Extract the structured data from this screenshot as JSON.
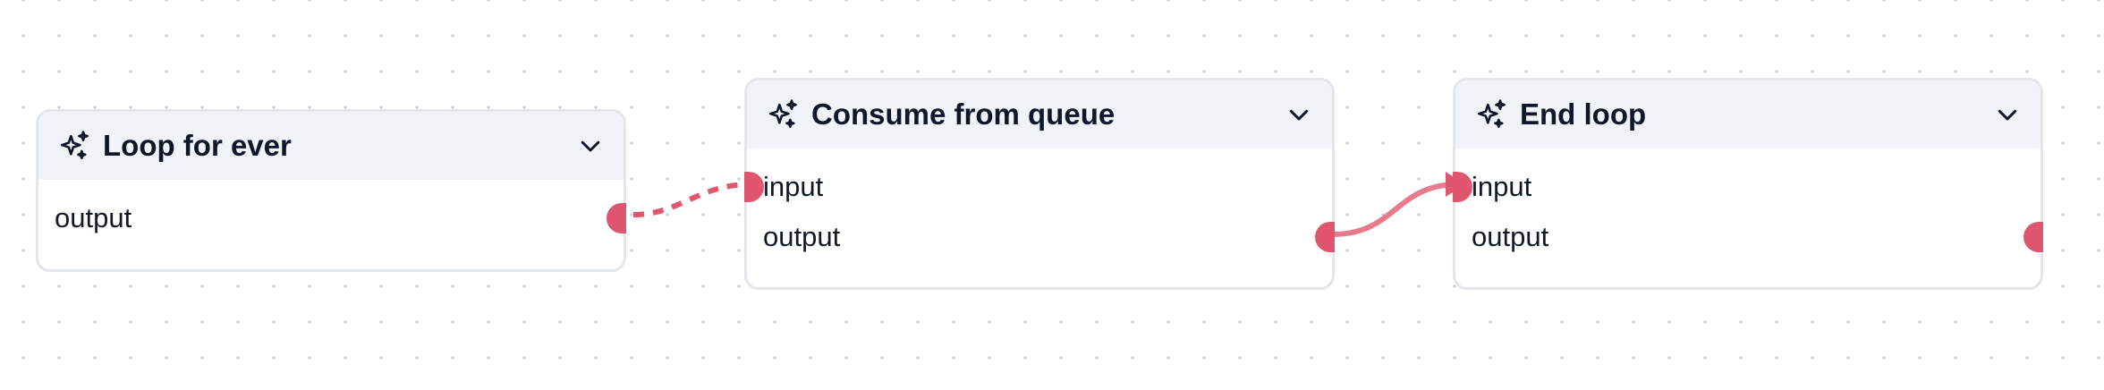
{
  "colors": {
    "edge": "#e0566e",
    "edge_active": "#e87a8c",
    "node_border": "#e3e6ea",
    "header_bg": "#f0f4f8",
    "dot_grid": "#c9ced6"
  },
  "nodes": [
    {
      "id": "loop-for-ever",
      "title": "Loop for ever",
      "icon": "sparkles-icon",
      "outputs": [
        "output"
      ]
    },
    {
      "id": "consume-from-queue",
      "title": "Consume from queue",
      "icon": "sparkles-icon",
      "inputs": [
        "input"
      ],
      "outputs": [
        "output"
      ]
    },
    {
      "id": "end-loop",
      "title": "End loop",
      "icon": "sparkles-icon",
      "inputs": [
        "input"
      ],
      "outputs": [
        "output"
      ]
    }
  ],
  "edges": [
    {
      "from": "loop-for-ever.output",
      "to": "consume-from-queue.input",
      "style": "dashed"
    },
    {
      "from": "consume-from-queue.output",
      "to": "end-loop.input",
      "style": "solid"
    }
  ]
}
